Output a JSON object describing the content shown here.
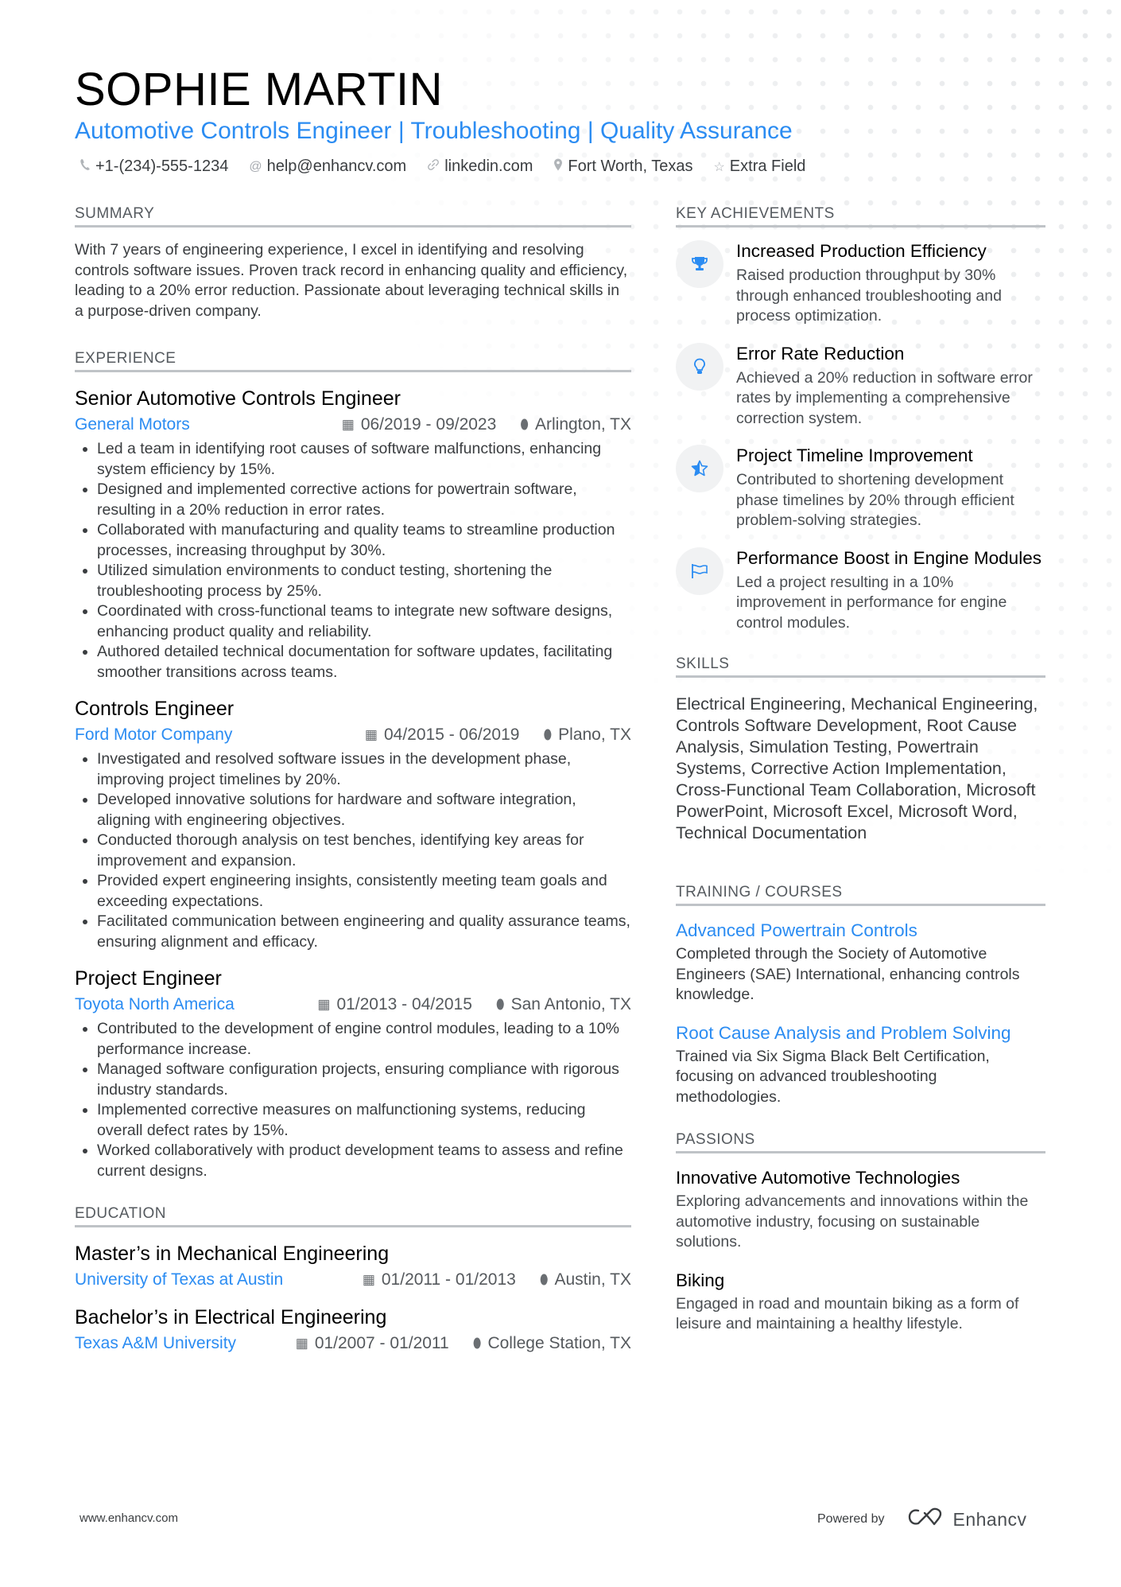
{
  "header": {
    "name": "SOPHIE MARTIN",
    "title": "Automotive Controls Engineer | Troubleshooting | Quality Assurance",
    "contacts": [
      {
        "icon": "phone-icon",
        "text": "+1-(234)-555-1234"
      },
      {
        "icon": "at-icon",
        "text": "help@enhancv.com"
      },
      {
        "icon": "link-icon",
        "text": "linkedin.com"
      },
      {
        "icon": "location-icon",
        "text": "Fort Worth, Texas"
      },
      {
        "icon": "star-icon",
        "text": "Extra Field"
      }
    ]
  },
  "summary": {
    "heading": "SUMMARY",
    "text": "With 7 years of engineering experience, I excel in identifying and resolving controls software issues. Proven track record in enhancing quality and efficiency, leading to a 20% error reduction. Passionate about leveraging technical skills in a purpose-driven company."
  },
  "experience": {
    "heading": "EXPERIENCE",
    "jobs": [
      {
        "title": "Senior Automotive Controls Engineer",
        "company": "General Motors",
        "dates": "06/2019 - 09/2023",
        "location": "Arlington, TX",
        "bullets": [
          "Led a team in identifying root causes of software malfunctions, enhancing system efficiency by 15%.",
          "Designed and implemented corrective actions for powertrain software, resulting in a 20% reduction in error rates.",
          "Collaborated with manufacturing and quality teams to streamline production processes, increasing throughput by 30%.",
          "Utilized simulation environments to conduct testing, shortening the troubleshooting process by 25%.",
          "Coordinated with cross-functional teams to integrate new software designs, enhancing product quality and reliability.",
          "Authored detailed technical documentation for software updates, facilitating smoother transitions across teams."
        ]
      },
      {
        "title": "Controls Engineer",
        "company": "Ford Motor Company",
        "dates": "04/2015 - 06/2019",
        "location": "Plano, TX",
        "bullets": [
          "Investigated and resolved software issues in the development phase, improving project timelines by 20%.",
          "Developed innovative solutions for hardware and software integration, aligning with engineering objectives.",
          "Conducted thorough analysis on test benches, identifying key areas for improvement and expansion.",
          "Provided expert engineering insights, consistently meeting team goals and exceeding expectations.",
          "Facilitated communication between engineering and quality assurance teams, ensuring alignment and efficacy."
        ]
      },
      {
        "title": "Project Engineer",
        "company": "Toyota North America",
        "dates": "01/2013 - 04/2015",
        "location": "San Antonio, TX",
        "bullets": [
          "Contributed to the development of engine control modules, leading to a 10% performance increase.",
          "Managed software configuration projects, ensuring compliance with rigorous industry standards.",
          "Implemented corrective measures on malfunctioning systems, reducing overall defect rates by 15%.",
          "Worked collaboratively with product development teams to assess and refine current designs."
        ]
      }
    ]
  },
  "education": {
    "heading": "EDUCATION",
    "items": [
      {
        "degree": "Master’s in Mechanical Engineering",
        "school": "University of Texas at Austin",
        "dates": "01/2011 - 01/2013",
        "location": "Austin, TX"
      },
      {
        "degree": "Bachelor’s in Electrical Engineering",
        "school": "Texas A&M University",
        "dates": "01/2007 - 01/2011",
        "location": "College Station, TX"
      }
    ]
  },
  "achievements": {
    "heading": "KEY ACHIEVEMENTS",
    "items": [
      {
        "icon": "trophy-icon",
        "title": "Increased Production Efficiency",
        "desc": "Raised production throughput by 30% through enhanced troubleshooting and process optimization."
      },
      {
        "icon": "lightbulb-icon",
        "title": "Error Rate Reduction",
        "desc": "Achieved a 20% reduction in software error rates by implementing a comprehensive correction system."
      },
      {
        "icon": "star-half-icon",
        "title": "Project Timeline Improvement",
        "desc": "Contributed to shortening development phase timelines by 20% through efficient problem-solving strategies."
      },
      {
        "icon": "flag-icon",
        "title": "Performance Boost in Engine Modules",
        "desc": "Led a project resulting in a 10% improvement in performance for engine control modules."
      }
    ]
  },
  "skills": {
    "heading": "SKILLS",
    "text": "Electrical Engineering, Mechanical Engineering, Controls Software Development, Root Cause Analysis, Simulation Testing, Powertrain Systems, Corrective Action Implementation, Cross-Functional Team Collaboration, Microsoft PowerPoint, Microsoft Excel, Microsoft Word, Technical Documentation"
  },
  "training": {
    "heading": "TRAINING / COURSES",
    "items": [
      {
        "title": "Advanced Powertrain Controls",
        "desc": "Completed through the Society of Automotive Engineers (SAE) International, enhancing controls knowledge."
      },
      {
        "title": "Root Cause Analysis and Problem Solving",
        "desc": "Trained via Six Sigma Black Belt Certification, focusing on advanced troubleshooting methodologies."
      }
    ]
  },
  "passions": {
    "heading": "PASSIONS",
    "items": [
      {
        "title": "Innovative Automotive Technologies",
        "desc": "Exploring advancements and innovations within the automotive industry, focusing on sustainable solutions."
      },
      {
        "title": "Biking",
        "desc": "Engaged in road and mountain biking as a form of leisure and maintaining a healthy lifestyle."
      }
    ]
  },
  "footer": {
    "website": "www.enhancv.com",
    "powered_by": "Powered by",
    "brand": "Enhancv"
  },
  "colors": {
    "accent": "#2b8cf2",
    "heading_rule": "#bfc3c7",
    "icon_bg": "#f1f2f3"
  }
}
